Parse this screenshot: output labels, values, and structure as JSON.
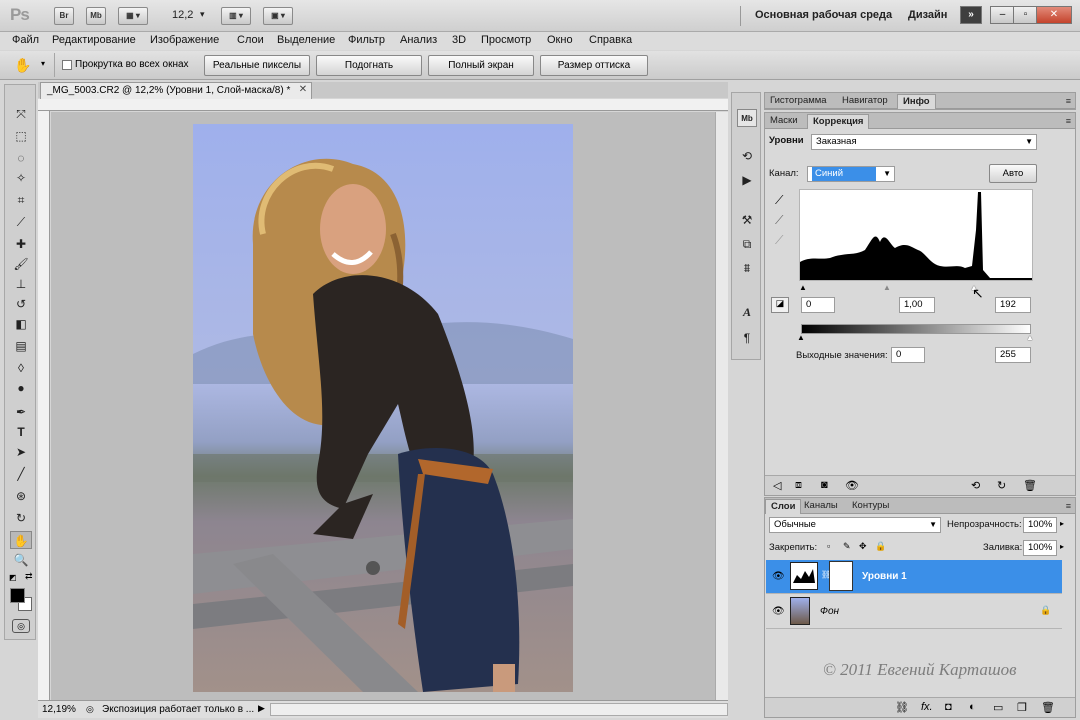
{
  "app": {
    "logo": "Ps",
    "zoom": "12,2",
    "workspace": "Основная рабочая среда",
    "design": "Дизайн",
    "br_label": "Br",
    "mb_label": "Mb"
  },
  "menu": [
    "Файл",
    "Редактирование",
    "Изображение",
    "Слои",
    "Выделение",
    "Фильтр",
    "Анализ",
    "3D",
    "Просмотр",
    "Окно",
    "Справка"
  ],
  "options": {
    "scroll_all": "Прокрутка во всех окнах",
    "buttons": [
      "Реальные пикселы",
      "Подогнать",
      "Полный экран",
      "Размер оттиска"
    ]
  },
  "document": {
    "tab_title": "_MG_5003.CR2 @ 12,2% (Уровни 1, Слой-маска/8) *",
    "status_zoom": "12,19%",
    "status_text": "Экспозиция работает только в ..."
  },
  "panels_top": {
    "tabs": [
      "Гистограмма",
      "Навигатор",
      "Инфо"
    ],
    "active": "Инфо"
  },
  "adjust": {
    "tabs": [
      "Маски",
      "Коррекция"
    ],
    "levels_label": "Уровни",
    "preset": "Заказная",
    "channel_label": "Канал:",
    "channel_value": "Синий",
    "auto_button": "Авто",
    "input_black": "0",
    "input_gamma": "1,00",
    "input_white": "192",
    "output_label": "Выходные значения:",
    "output_black": "0",
    "output_white": "255"
  },
  "layers": {
    "tabs": [
      "Слои",
      "Каналы",
      "Контуры"
    ],
    "blend_mode": "Обычные",
    "opacity_label": "Непрозрачность:",
    "opacity": "100%",
    "lock_label": "Закрепить:",
    "fill_label": "Заливка:",
    "fill": "100%",
    "items": [
      {
        "name": "Уровни 1",
        "selected": true
      },
      {
        "name": "Фон",
        "selected": false
      }
    ]
  },
  "watermark": "© 2011 Евгений Карташов",
  "colors": {
    "selection": "#3b8fe8",
    "sky": "#a8b6e6"
  }
}
